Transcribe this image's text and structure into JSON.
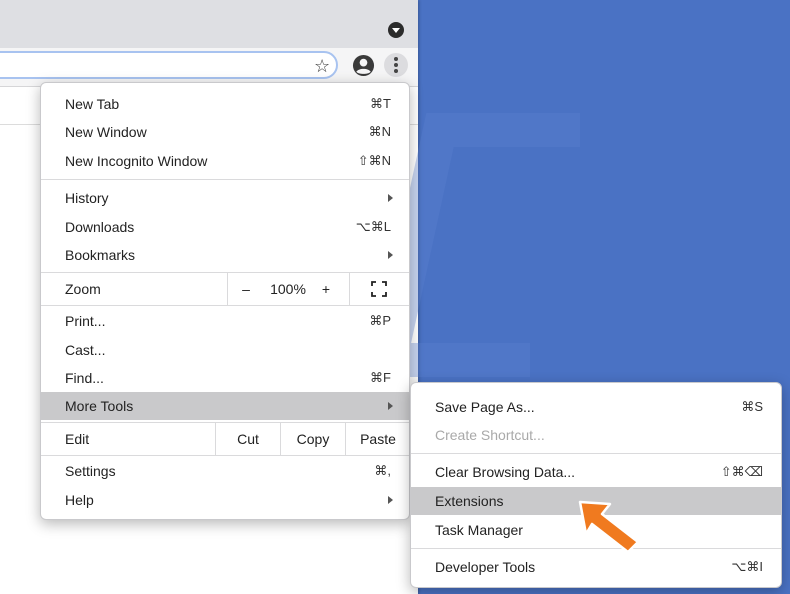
{
  "menu": {
    "new_tab": {
      "label": "New Tab",
      "shortcut": "⌘T"
    },
    "new_window": {
      "label": "New Window",
      "shortcut": "⌘N"
    },
    "new_incognito": {
      "label": "New Incognito Window",
      "shortcut": "⇧⌘N"
    },
    "history": {
      "label": "History"
    },
    "downloads": {
      "label": "Downloads",
      "shortcut": "⌥⌘L"
    },
    "bookmarks": {
      "label": "Bookmarks"
    },
    "zoom": {
      "label": "Zoom",
      "minus": "–",
      "value": "100%",
      "plus": "+"
    },
    "print": {
      "label": "Print...",
      "shortcut": "⌘P"
    },
    "cast": {
      "label": "Cast..."
    },
    "find": {
      "label": "Find...",
      "shortcut": "⌘F"
    },
    "more_tools": {
      "label": "More Tools"
    },
    "edit": {
      "label": "Edit",
      "cut": "Cut",
      "copy": "Copy",
      "paste": "Paste"
    },
    "settings": {
      "label": "Settings",
      "shortcut": "⌘,"
    },
    "help": {
      "label": "Help"
    }
  },
  "submenu": {
    "save_page": {
      "label": "Save Page As...",
      "shortcut": "⌘S"
    },
    "create_shortcut": {
      "label": "Create Shortcut..."
    },
    "clear_data": {
      "label": "Clear Browsing Data...",
      "shortcut": "⇧⌘⌫"
    },
    "extensions": {
      "label": "Extensions"
    },
    "task_manager": {
      "label": "Task Manager"
    },
    "dev_tools": {
      "label": "Developer Tools",
      "shortcut": "⌥⌘I"
    }
  },
  "colors": {
    "background": "#4a72c4",
    "highlight": "#c9c9cb",
    "arrow": "#f07a1f"
  },
  "icons": [
    "bookmark-star-icon",
    "profile-avatar-icon",
    "kebab-menu-icon",
    "tab-search-icon",
    "fullscreen-icon",
    "pointer-arrow-icon"
  ]
}
